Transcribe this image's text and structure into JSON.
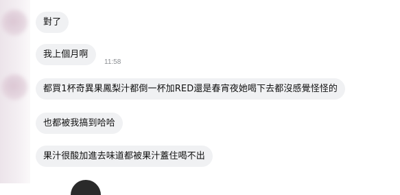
{
  "chat": {
    "messages": [
      {
        "text": "對了"
      },
      {
        "text": "我上個月啊"
      },
      {
        "text": "都買1杯奇異果鳳梨汁都倒一杯加RED還是春宵夜她喝下去都沒感覺怪怪的"
      },
      {
        "text": "也都被我搞到哈哈"
      },
      {
        "text": "果汁很酸加進去味道都被果汁蓋住喝不出"
      }
    ],
    "timestamp": "11:58"
  },
  "colors": {
    "bubble_background": "#f0f1f3",
    "timestamp_text": "#8a8d91",
    "page_background": "#ffffff"
  }
}
